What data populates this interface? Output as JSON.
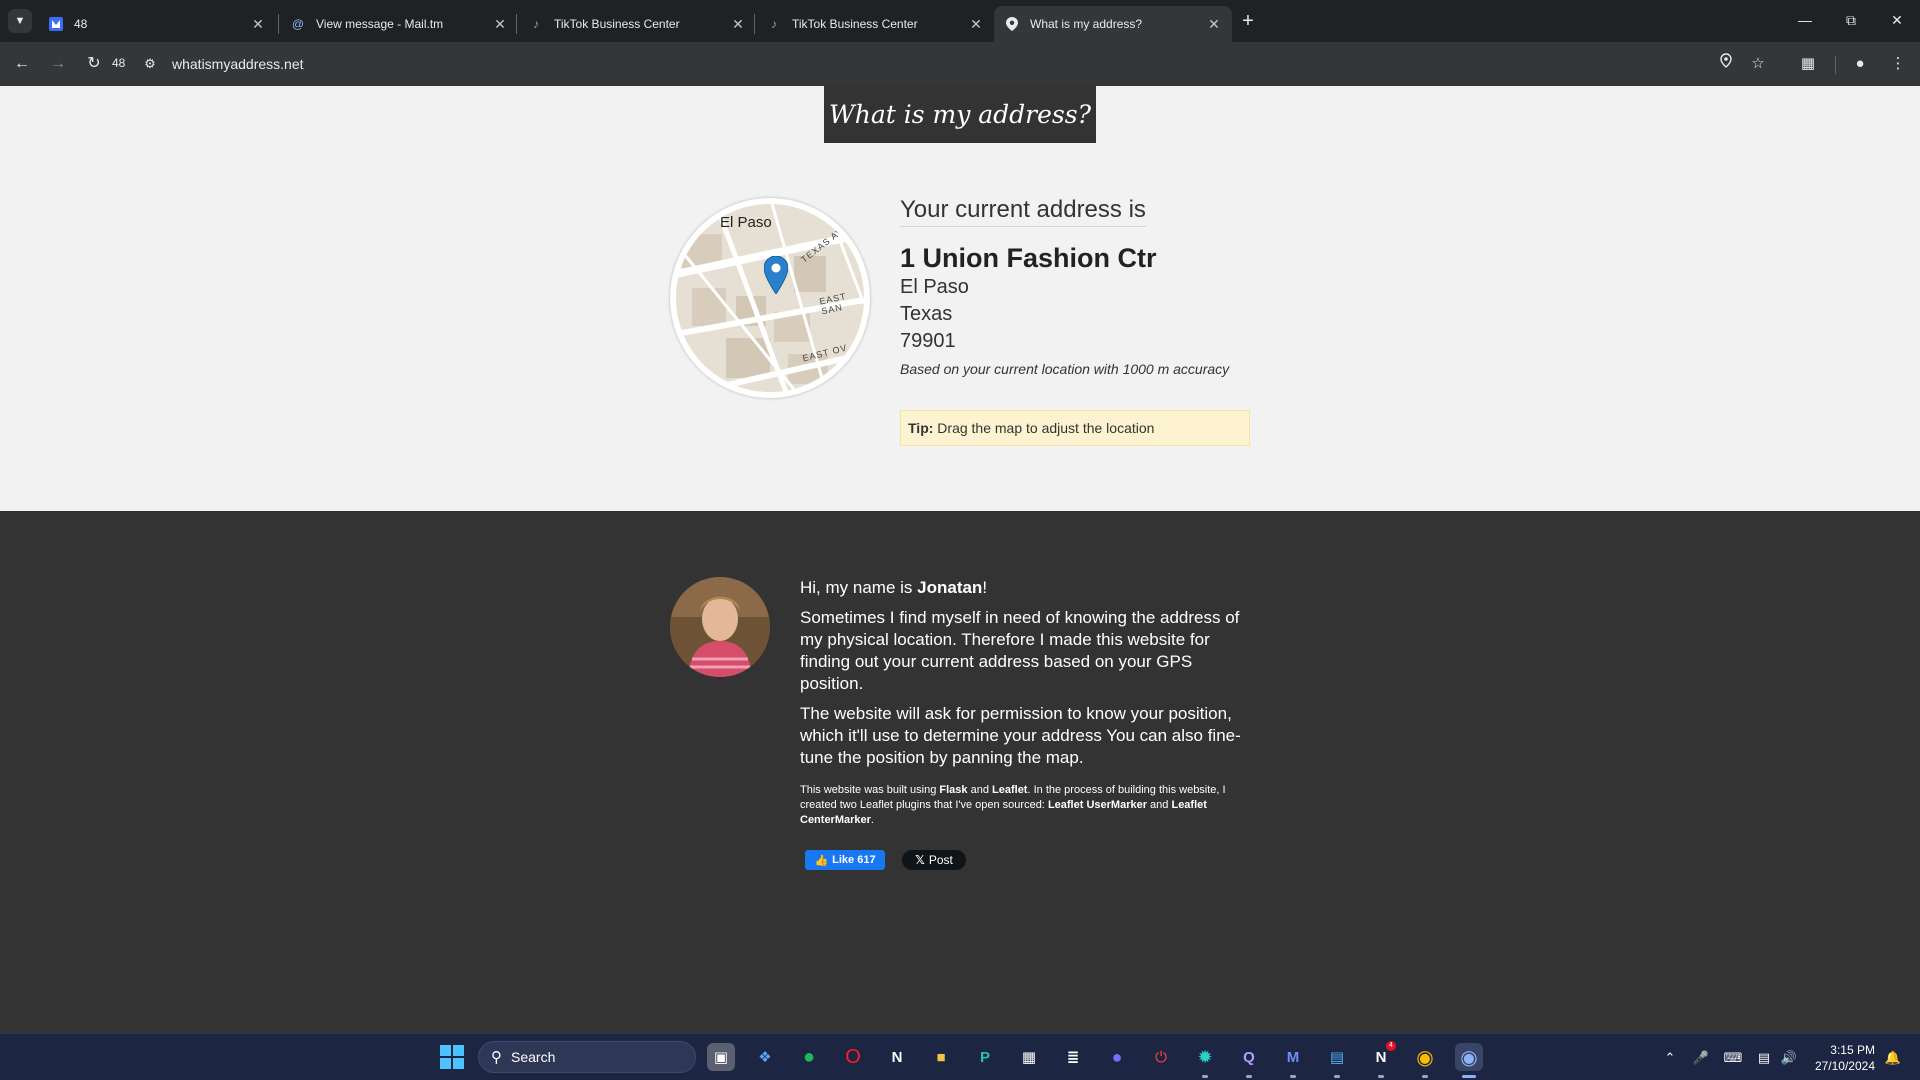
{
  "browser": {
    "tabs": [
      {
        "title": "48",
        "active": false
      },
      {
        "title": "View message - Mail.tm",
        "active": false
      },
      {
        "title": "TikTok Business Center",
        "active": false
      },
      {
        "title": "TikTok Business Center",
        "active": false
      },
      {
        "title": "What is my address?",
        "active": true
      }
    ],
    "reload_count": "48",
    "url": "whatismyaddress.net"
  },
  "page": {
    "logo_text": "What is my address?",
    "map_city_label": "El Paso",
    "map_streets": [
      "TEXAS AVE",
      "EAST SAN",
      "EAST OV"
    ],
    "lead": "Your current address is",
    "street": "1 Union Fashion Ctr",
    "city": "El Paso",
    "state": "Texas",
    "zip": "79901",
    "accuracy": "Based on your current location with 1000 m accuracy",
    "tip_label": "Tip:",
    "tip_text": " Drag the map to adjust the location"
  },
  "about": {
    "hi_prefix": "Hi, my name is ",
    "name": "Jonatan",
    "hi_suffix": "!",
    "para1": "Sometimes I find myself in need of knowing the address of my physical location. Therefore I made this website for finding out your current address based on your GPS position.",
    "para2": "The website will ask for permission to know your position, which it'll use to determine your address You can also fine-tune the position by panning the map.",
    "built_1": "This website was built using ",
    "built_flask": "Flask",
    "built_2": " and ",
    "built_leaflet": "Leaflet",
    "built_3": ". In the process of building this website, I created two Leaflet plugins that I've open sourced: ",
    "built_plugin1": "Leaflet UserMarker",
    "built_4": " and ",
    "built_plugin2": "Leaflet CenterMarker",
    "built_5": ".",
    "like_label": "Like 617",
    "post_label": "Post"
  },
  "taskbar": {
    "search_placeholder": "Search",
    "time": "3:15 PM",
    "date": "27/10/2024",
    "notion_badge": "4"
  },
  "colors": {
    "tab_bar": "#202124",
    "toolbar": "#35363a",
    "page_bg": "#f2f2f2",
    "footer_bg": "#333333",
    "tip_bg": "#fdf3d1",
    "like_blue": "#1877f2",
    "pin_blue": "#2a81cb",
    "taskbar": "#1c2541"
  }
}
